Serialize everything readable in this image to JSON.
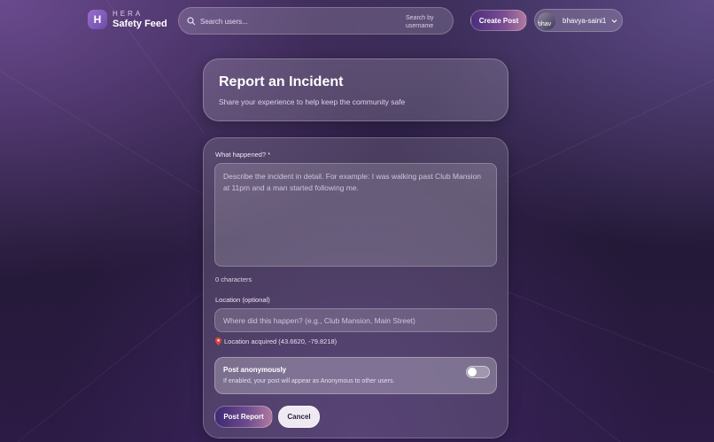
{
  "header": {
    "logo_letter": "H",
    "brand_small": "HERA",
    "brand_main": "Safety Feed",
    "search_placeholder": "Search users...",
    "search_hint": "Search by username",
    "create_post_label": "Create Post",
    "avatar_alt": "bhav",
    "username": "bhavya-saini1"
  },
  "title_card": {
    "title": "Report an Incident",
    "subtitle": "Share your experience to help keep the community safe"
  },
  "form": {
    "what_label": "What happened? *",
    "what_placeholder": "Describe the incident in detail. For example: I was walking past Club Mansion at 11pm and a man started following me.",
    "char_count": "0 characters",
    "location_label": "Location (optional)",
    "location_placeholder": "Where did this happen? (e.g., Club Mansion, Main Street)",
    "location_status": "Location acquired (43.6620, -79.8218)",
    "anon_title": "Post anonymously",
    "anon_desc": "If enabled, your post will appear as Anonymous to other users.",
    "anon_enabled": false,
    "post_label": "Post Report",
    "cancel_label": "Cancel"
  },
  "colors": {
    "accent_start": "#3f2873",
    "accent_end": "#b07aa2",
    "pin": "#e0453a"
  },
  "icons": {
    "search": "search-icon",
    "chevron": "chevron-down-icon",
    "pin": "map-pin-icon"
  }
}
